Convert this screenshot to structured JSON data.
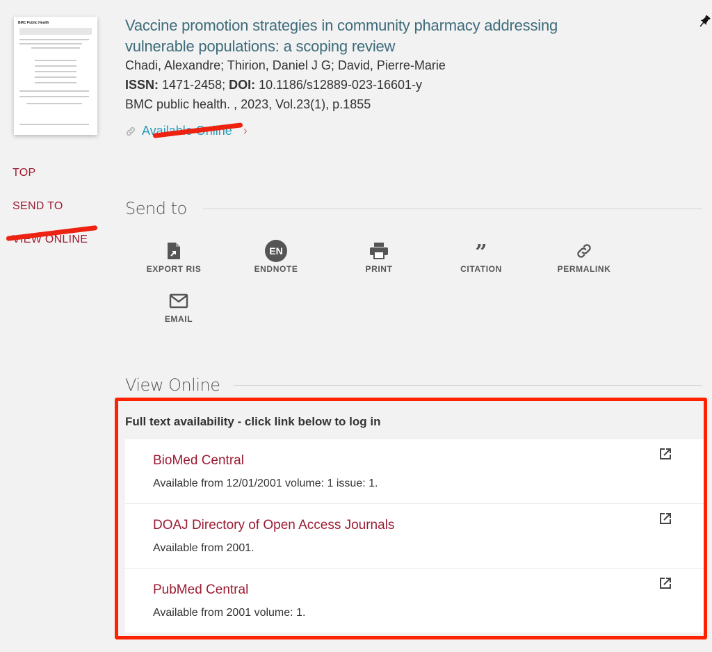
{
  "record": {
    "title": "Vaccine promotion strategies in community pharmacy addressing vulnerable populations: a scoping review",
    "authors": "Chadi, Alexandre; Thirion, Daniel J G; David, Pierre-Marie",
    "issn_label": "ISSN:",
    "issn": "1471-2458;",
    "doi_label": "DOI:",
    "doi": "10.1186/s12889-023-16601-y",
    "source": "BMC public health. , 2023, Vol.23(1), p.1855",
    "availability_link": "Available Online",
    "thumbnail_header": "BMC Public Health"
  },
  "sidenav": {
    "items": [
      {
        "label": "TOP"
      },
      {
        "label": "SEND TO"
      },
      {
        "label": "VIEW ONLINE"
      }
    ]
  },
  "send_to": {
    "title": "Send to",
    "actions": [
      {
        "label": "EXPORT RIS",
        "icon": "export-ris-icon"
      },
      {
        "label": "ENDNOTE",
        "icon": "endnote-icon",
        "badge": "EN"
      },
      {
        "label": "PRINT",
        "icon": "print-icon"
      },
      {
        "label": "CITATION",
        "icon": "citation-icon"
      },
      {
        "label": "PERMALINK",
        "icon": "permalink-icon"
      },
      {
        "label": "EMAIL",
        "icon": "email-icon"
      }
    ]
  },
  "view_online": {
    "title": "View Online",
    "header": "Full text availability - click link below to log in",
    "providers": [
      {
        "name": "BioMed Central",
        "coverage": "Available from 12/01/2001 volume: 1 issue: 1."
      },
      {
        "name": "DOAJ Directory of Open Access Journals",
        "coverage": "Available from 2001."
      },
      {
        "name": "PubMed Central",
        "coverage": "Available from 2001 volume: 1."
      }
    ]
  },
  "colors": {
    "title": "#3d6b7a",
    "link": "#9c1b32",
    "annotation": "#ff2200"
  }
}
